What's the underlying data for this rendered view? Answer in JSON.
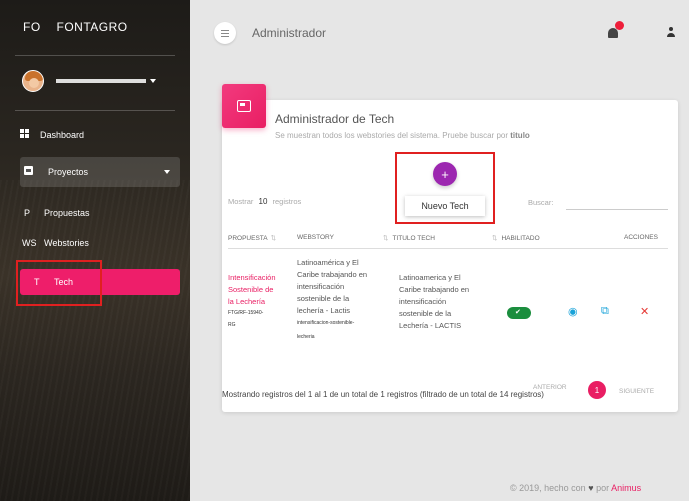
{
  "sidebar": {
    "brand_abbr": "FO",
    "brand_name": "FONTAGRO",
    "user_name": "",
    "items": [
      {
        "label": "Dashboard",
        "icon": "dashboard-icon"
      },
      {
        "label": "Proyectos",
        "icon": "clipboard-icon"
      },
      {
        "abbr": "P",
        "label": "Propuestas"
      },
      {
        "abbr": "WS",
        "label": "Webstories"
      },
      {
        "abbr": "T",
        "label": "Tech"
      }
    ]
  },
  "topbar": {
    "title": "Administrador",
    "menu_icon": "menu-icon",
    "notification_icon": "bell-icon",
    "user_icon": "person-icon"
  },
  "card": {
    "title": "Administrador de Tech",
    "subtitle_prefix": "Se muestran todos los webstories del sistema. Pruebe buscar por",
    "subtitle_bold": "titulo",
    "add_button": "+",
    "tooltip": "Nuevo Tech",
    "show_label": "Mostrar",
    "show_value": "10",
    "show_suffix": "registros",
    "search_label": "Buscar:",
    "search_value": ""
  },
  "table": {
    "headers": [
      "PROPUESTA",
      "WEBSTORY",
      "TITULO TECH",
      "HABILITADO",
      "ACCIONES"
    ],
    "row": {
      "propuesta_line1": "Intensificación",
      "propuesta_line2": "Sostenible de",
      "propuesta_line3": "la Lechería",
      "propuesta_code": "FTG/RF-15940-",
      "propuesta_code2": "RG",
      "webstory_line1": "Latinoamérica y El",
      "webstory_line2": "Caribe trabajando en",
      "webstory_line3": "intensificación",
      "webstory_line4": "sostenible de la",
      "webstory_line5": "lechería - Lactis",
      "webstory_slug": "intensificacion-sostenible-",
      "webstory_slug2": "lecheria",
      "titulo_line1": "Latinoamerica y El",
      "titulo_line2": "Caribe trabajando en",
      "titulo_line3": "intensificación",
      "titulo_line4": "sostenible de la",
      "titulo_line5": "Lechería - LACTIS",
      "habilitado": true
    },
    "actions": {
      "view": "eye-icon",
      "edit": "edit-icon",
      "delete": "close-icon"
    }
  },
  "footer": {
    "info": "Mostrando registros del 1 al 1 de un total de 1 registros (filtrado de un total de 14 registros)",
    "prev": "ANTERIOR",
    "page": "1",
    "next": "SIGUIENTE",
    "credits_prefix": "© 2019, hecho con",
    "credits_by": "por",
    "credits_brand": "Animus"
  },
  "colors": {
    "accent": "#e91e63",
    "add_button": "#9c27b0",
    "toggle_on": "#1b8e3e",
    "highlight_box": "#e02020"
  }
}
